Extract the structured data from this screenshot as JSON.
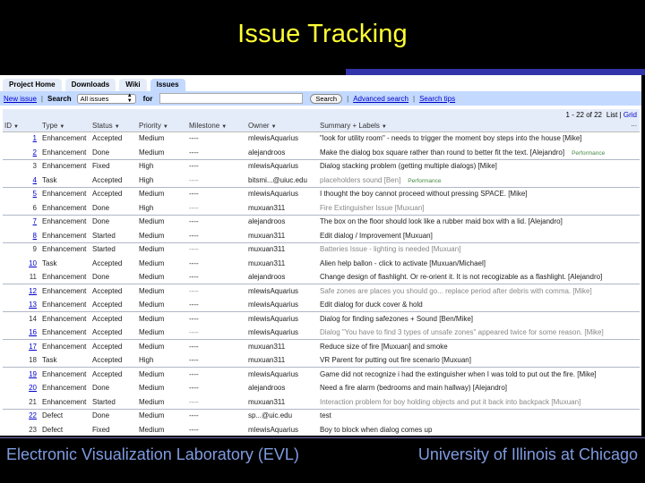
{
  "slide": {
    "title": "Issue Tracking",
    "footer_left": "Electronic Visualization Laboratory (EVL)",
    "footer_right": "University of Illinois at Chicago",
    "colors": {
      "title": "#ffff33",
      "footer": "#7f9be0",
      "accent_bar": "#3333aa"
    }
  },
  "tabs": [
    {
      "label": "Project Home",
      "active": false
    },
    {
      "label": "Downloads",
      "active": false
    },
    {
      "label": "Wiki",
      "active": false
    },
    {
      "label": "Issues",
      "active": true
    }
  ],
  "searchbar": {
    "new_issue": "New issue",
    "search_label": "Search",
    "select_value": "All issues",
    "for_label": "for",
    "query_value": "",
    "search_button": "Search",
    "advanced_search": "Advanced search",
    "search_tips": "Search tips"
  },
  "pager": {
    "count": "1 - 22 of 22",
    "list_label": "List",
    "grid_label": "Grid"
  },
  "columns": [
    "ID",
    "Type",
    "Status",
    "Priority",
    "Milestone",
    "Owner",
    "Summary + Labels"
  ],
  "more_columns": "...",
  "rows": [
    {
      "id": "1",
      "link": true,
      "type": "Enhancement",
      "status": "Accepted",
      "priority": "Medium",
      "milestone": "----",
      "owner": "mlewisAquarius",
      "summary": "\"look for utility room\" - needs to trigger the moment boy steps into the house [Mike]",
      "label": "",
      "dim": false
    },
    {
      "id": "2",
      "link": true,
      "type": "Enhancement",
      "status": "Done",
      "priority": "Medium",
      "milestone": "----",
      "owner": "alejandroos",
      "summary": "Make the dialog box square rather than round to better fit the text. [Alejandro]",
      "label": "Performance",
      "dim": false
    },
    {
      "id": "3",
      "link": false,
      "type": "Enhancement",
      "status": "Fixed",
      "priority": "High",
      "milestone": "----",
      "owner": "mlewisAquarius",
      "summary": "Dialog stacking problem (getting multiple dialogs) [Mike]",
      "label": "",
      "dim": false
    },
    {
      "id": "4",
      "link": true,
      "type": "Task",
      "status": "Accepted",
      "priority": "High",
      "milestone": "----",
      "owner": "bitsmi...@uiuc.edu",
      "summary": "placeholders sound [Ben]",
      "label": "Performance",
      "dim": true
    },
    {
      "id": "5",
      "link": true,
      "type": "Enhancement",
      "status": "Accepted",
      "priority": "Medium",
      "milestone": "----",
      "owner": "mlewisAquarius",
      "summary": "I thought the boy cannot proceed without pressing SPACE. [Mike]",
      "label": "",
      "dim": false
    },
    {
      "id": "6",
      "link": false,
      "type": "Enhancement",
      "status": "Done",
      "priority": "High",
      "milestone": "----",
      "owner": "muxuan311",
      "summary": "Fire Extinguisher Issue [Muxuan]",
      "label": "",
      "dim": true
    },
    {
      "id": "7",
      "link": true,
      "type": "Enhancement",
      "status": "Done",
      "priority": "Medium",
      "milestone": "----",
      "owner": "alejandroos",
      "summary": "The box on the floor should look like a rubber maid box with a lid. [Alejandro]",
      "label": "",
      "dim": false
    },
    {
      "id": "8",
      "link": true,
      "type": "Enhancement",
      "status": "Started",
      "priority": "Medium",
      "milestone": "----",
      "owner": "muxuan311",
      "summary": "Edit dialog / Improvement [Muxuan]",
      "label": "",
      "dim": false
    },
    {
      "id": "9",
      "link": false,
      "type": "Enhancement",
      "status": "Started",
      "priority": "Medium",
      "milestone": "----",
      "owner": "muxuan311",
      "summary": "Batteries Issue - lighting is needed [Muxuan]",
      "label": "",
      "dim": true
    },
    {
      "id": "10",
      "link": true,
      "type": "Task",
      "status": "Accepted",
      "priority": "Medium",
      "milestone": "----",
      "owner": "muxuan311",
      "summary": "Alien help ballon - click to activate [Muxuan/Michael]",
      "label": "",
      "dim": false
    },
    {
      "id": "11",
      "link": false,
      "type": "Enhancement",
      "status": "Done",
      "priority": "Medium",
      "milestone": "----",
      "owner": "alejandroos",
      "summary": "Change design of flashlight. Or re-orient it. It is not recogizable as a flashlight. [Alejandro]",
      "label": "",
      "dim": false
    },
    {
      "id": "12",
      "link": true,
      "type": "Enhancement",
      "status": "Accepted",
      "priority": "Medium",
      "milestone": "----",
      "owner": "mlewisAquarius",
      "summary": "Safe zones are places you should go... replace period after debris with comma. [Mike]",
      "label": "",
      "dim": true
    },
    {
      "id": "13",
      "link": true,
      "type": "Enhancement",
      "status": "Accepted",
      "priority": "Medium",
      "milestone": "----",
      "owner": "mlewisAquarius",
      "summary": "Edit dialog for duck cover & hold",
      "label": "",
      "dim": false
    },
    {
      "id": "14",
      "link": false,
      "type": "Enhancement",
      "status": "Accepted",
      "priority": "Medium",
      "milestone": "----",
      "owner": "mlewisAquarius",
      "summary": "Dialog for finding safezones + Sound [Ben/Mike]",
      "label": "",
      "dim": false
    },
    {
      "id": "16",
      "link": true,
      "type": "Enhancement",
      "status": "Accepted",
      "priority": "Medium",
      "milestone": "----",
      "owner": "mlewisAquarius",
      "summary": "Dialog \"You have to find 3 types of unsafe zones\" appeared twice for some reason. [Mike]",
      "label": "",
      "dim": true
    },
    {
      "id": "17",
      "link": true,
      "type": "Enhancement",
      "status": "Accepted",
      "priority": "Medium",
      "milestone": "----",
      "owner": "muxuan311",
      "summary": "Reduce size of fire [Muxuan] and smoke",
      "label": "",
      "dim": false
    },
    {
      "id": "18",
      "link": false,
      "type": "Task",
      "status": "Accepted",
      "priority": "High",
      "milestone": "----",
      "owner": "muxuan311",
      "summary": "VR Parent for putting out fire scenario [Muxuan]",
      "label": "",
      "dim": false
    },
    {
      "id": "19",
      "link": true,
      "type": "Enhancement",
      "status": "Accepted",
      "priority": "Medium",
      "milestone": "----",
      "owner": "mlewisAquarius",
      "summary": "Game did not recognize i had the extinguisher when I was told to put out the fire. [Mike]",
      "label": "",
      "dim": false
    },
    {
      "id": "20",
      "link": true,
      "type": "Enhancement",
      "status": "Done",
      "priority": "Medium",
      "milestone": "----",
      "owner": "alejandroos",
      "summary": "Need a fire alarm (bedrooms and main hallway) [Alejandro]",
      "label": "",
      "dim": false
    },
    {
      "id": "21",
      "link": false,
      "type": "Enhancement",
      "status": "Started",
      "priority": "Medium",
      "milestone": "----",
      "owner": "muxuan311",
      "summary": "Interaction problem for boy holding objects and put it back into backpack [Muxuan]",
      "label": "",
      "dim": true
    },
    {
      "id": "22",
      "link": true,
      "type": "Defect",
      "status": "Done",
      "priority": "Medium",
      "milestone": "----",
      "owner": "sp...@uic.edu",
      "summary": "test",
      "label": "",
      "dim": false
    },
    {
      "id": "23",
      "link": false,
      "type": "Defect",
      "status": "Fixed",
      "priority": "Medium",
      "milestone": "----",
      "owner": "mlewisAquarius",
      "summary": "Boy to block when dialog comes up",
      "label": "",
      "dim": false
    }
  ]
}
